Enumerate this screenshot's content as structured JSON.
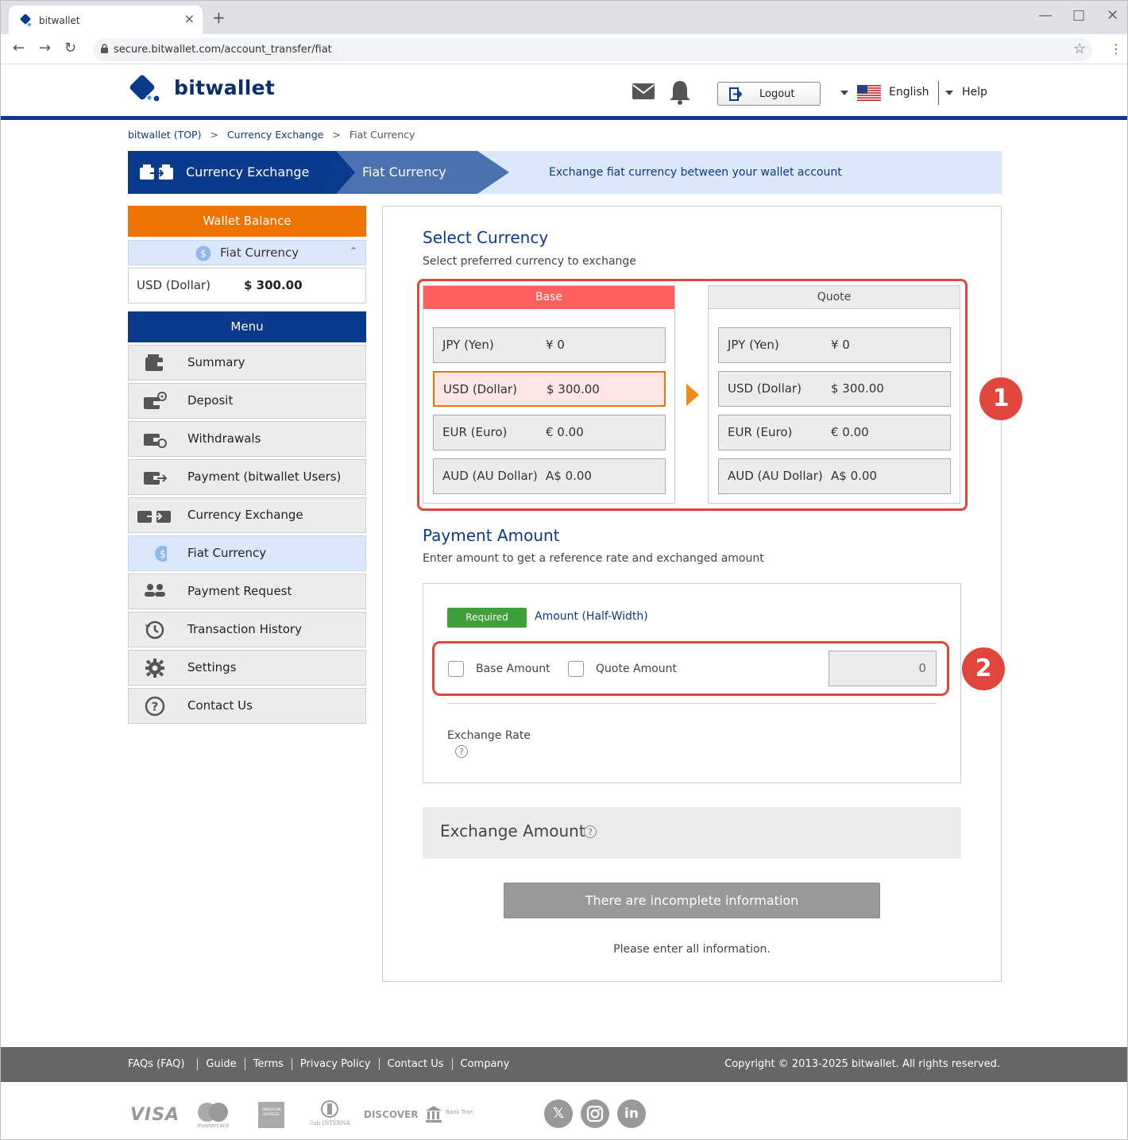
{
  "browser": {
    "tab_title": "bitwallet",
    "url": "secure.bitwallet.com/account_transfer/fiat"
  },
  "header": {
    "logo_text": "bitwallet",
    "logout_label": "Logout",
    "language_label": "English",
    "help_label": "Help"
  },
  "breadcrumb": {
    "items": [
      "bitwallet (TOP)",
      "Currency Exchange",
      "Fiat Currency"
    ],
    "separator": ">"
  },
  "banner": {
    "step1": "Currency Exchange",
    "step2": "Fiat Currency",
    "description": "Exchange fiat currency between your wallet account"
  },
  "sidebar": {
    "wallet_balance_title": "Wallet Balance",
    "balance_section_label": "Fiat Currency",
    "balance_currency": "USD (Dollar)",
    "balance_amount": "$ 300.00",
    "menu_title": "Menu",
    "items": [
      {
        "label": "Summary",
        "icon": "wallet-icon"
      },
      {
        "label": "Deposit",
        "icon": "deposit-icon"
      },
      {
        "label": "Withdrawals",
        "icon": "withdraw-icon"
      },
      {
        "label": "Payment (bitwallet Users)",
        "icon": "payment-icon"
      },
      {
        "label": "Currency Exchange",
        "icon": "exchange-icon"
      },
      {
        "label": "Fiat Currency",
        "icon": "dollar-circle-icon",
        "active": true
      },
      {
        "label": "Payment Request",
        "icon": "users-icon"
      },
      {
        "label": "Transaction History",
        "icon": "history-icon"
      },
      {
        "label": "Settings",
        "icon": "gear-icon"
      },
      {
        "label": "Contact Us",
        "icon": "question-icon"
      }
    ]
  },
  "select_currency": {
    "title": "Select Currency",
    "subtitle": "Select preferred currency to exchange",
    "base_header": "Base",
    "quote_header": "Quote",
    "base": [
      {
        "name": "JPY (Yen)",
        "value": "¥ 0"
      },
      {
        "name": "USD (Dollar)",
        "value": "$ 300.00",
        "selected": true
      },
      {
        "name": "EUR (Euro)",
        "value": "€ 0.00"
      },
      {
        "name": "AUD (AU Dollar)",
        "value": "A$ 0.00"
      }
    ],
    "quote": [
      {
        "name": "JPY (Yen)",
        "value": "¥ 0"
      },
      {
        "name": "USD (Dollar)",
        "value": "$ 300.00"
      },
      {
        "name": "EUR (Euro)",
        "value": "€ 0.00"
      },
      {
        "name": "AUD (AU Dollar)",
        "value": "A$ 0.00"
      }
    ],
    "badge": "1"
  },
  "payment_amount": {
    "title": "Payment Amount",
    "subtitle": "Enter amount to get a reference rate and exchanged amount",
    "required_label": "Required",
    "amount_label": "Amount (Half-Width)",
    "base_amount_label": "Base Amount",
    "quote_amount_label": "Quote Amount",
    "amount_value": "0",
    "exchange_rate_label": "Exchange Rate",
    "badge": "2"
  },
  "exchange_amount_label": "Exchange Amount",
  "submit_label": "There are incomplete information",
  "notice": "Please enter all information.",
  "footer": {
    "links": [
      "FAQs (FAQ)",
      "Guide",
      "Terms",
      "Privacy Policy",
      "Contact Us",
      "Company"
    ],
    "copyright": "Copyright © 2013-2025 bitwallet. All rights reserved.",
    "payment_methods": [
      "VISA",
      "mastercard",
      "AMERICAN EXPRESS",
      "Diners Club INTERNATIONAL",
      "DISCOVER",
      "Bank Transfer"
    ]
  },
  "colors": {
    "brand_navy": "#0a3a8c",
    "accent_orange": "#ef7300",
    "annotation_red": "#e0463c",
    "base_header": "#ff5f5f",
    "required_green": "#3f9f38"
  }
}
